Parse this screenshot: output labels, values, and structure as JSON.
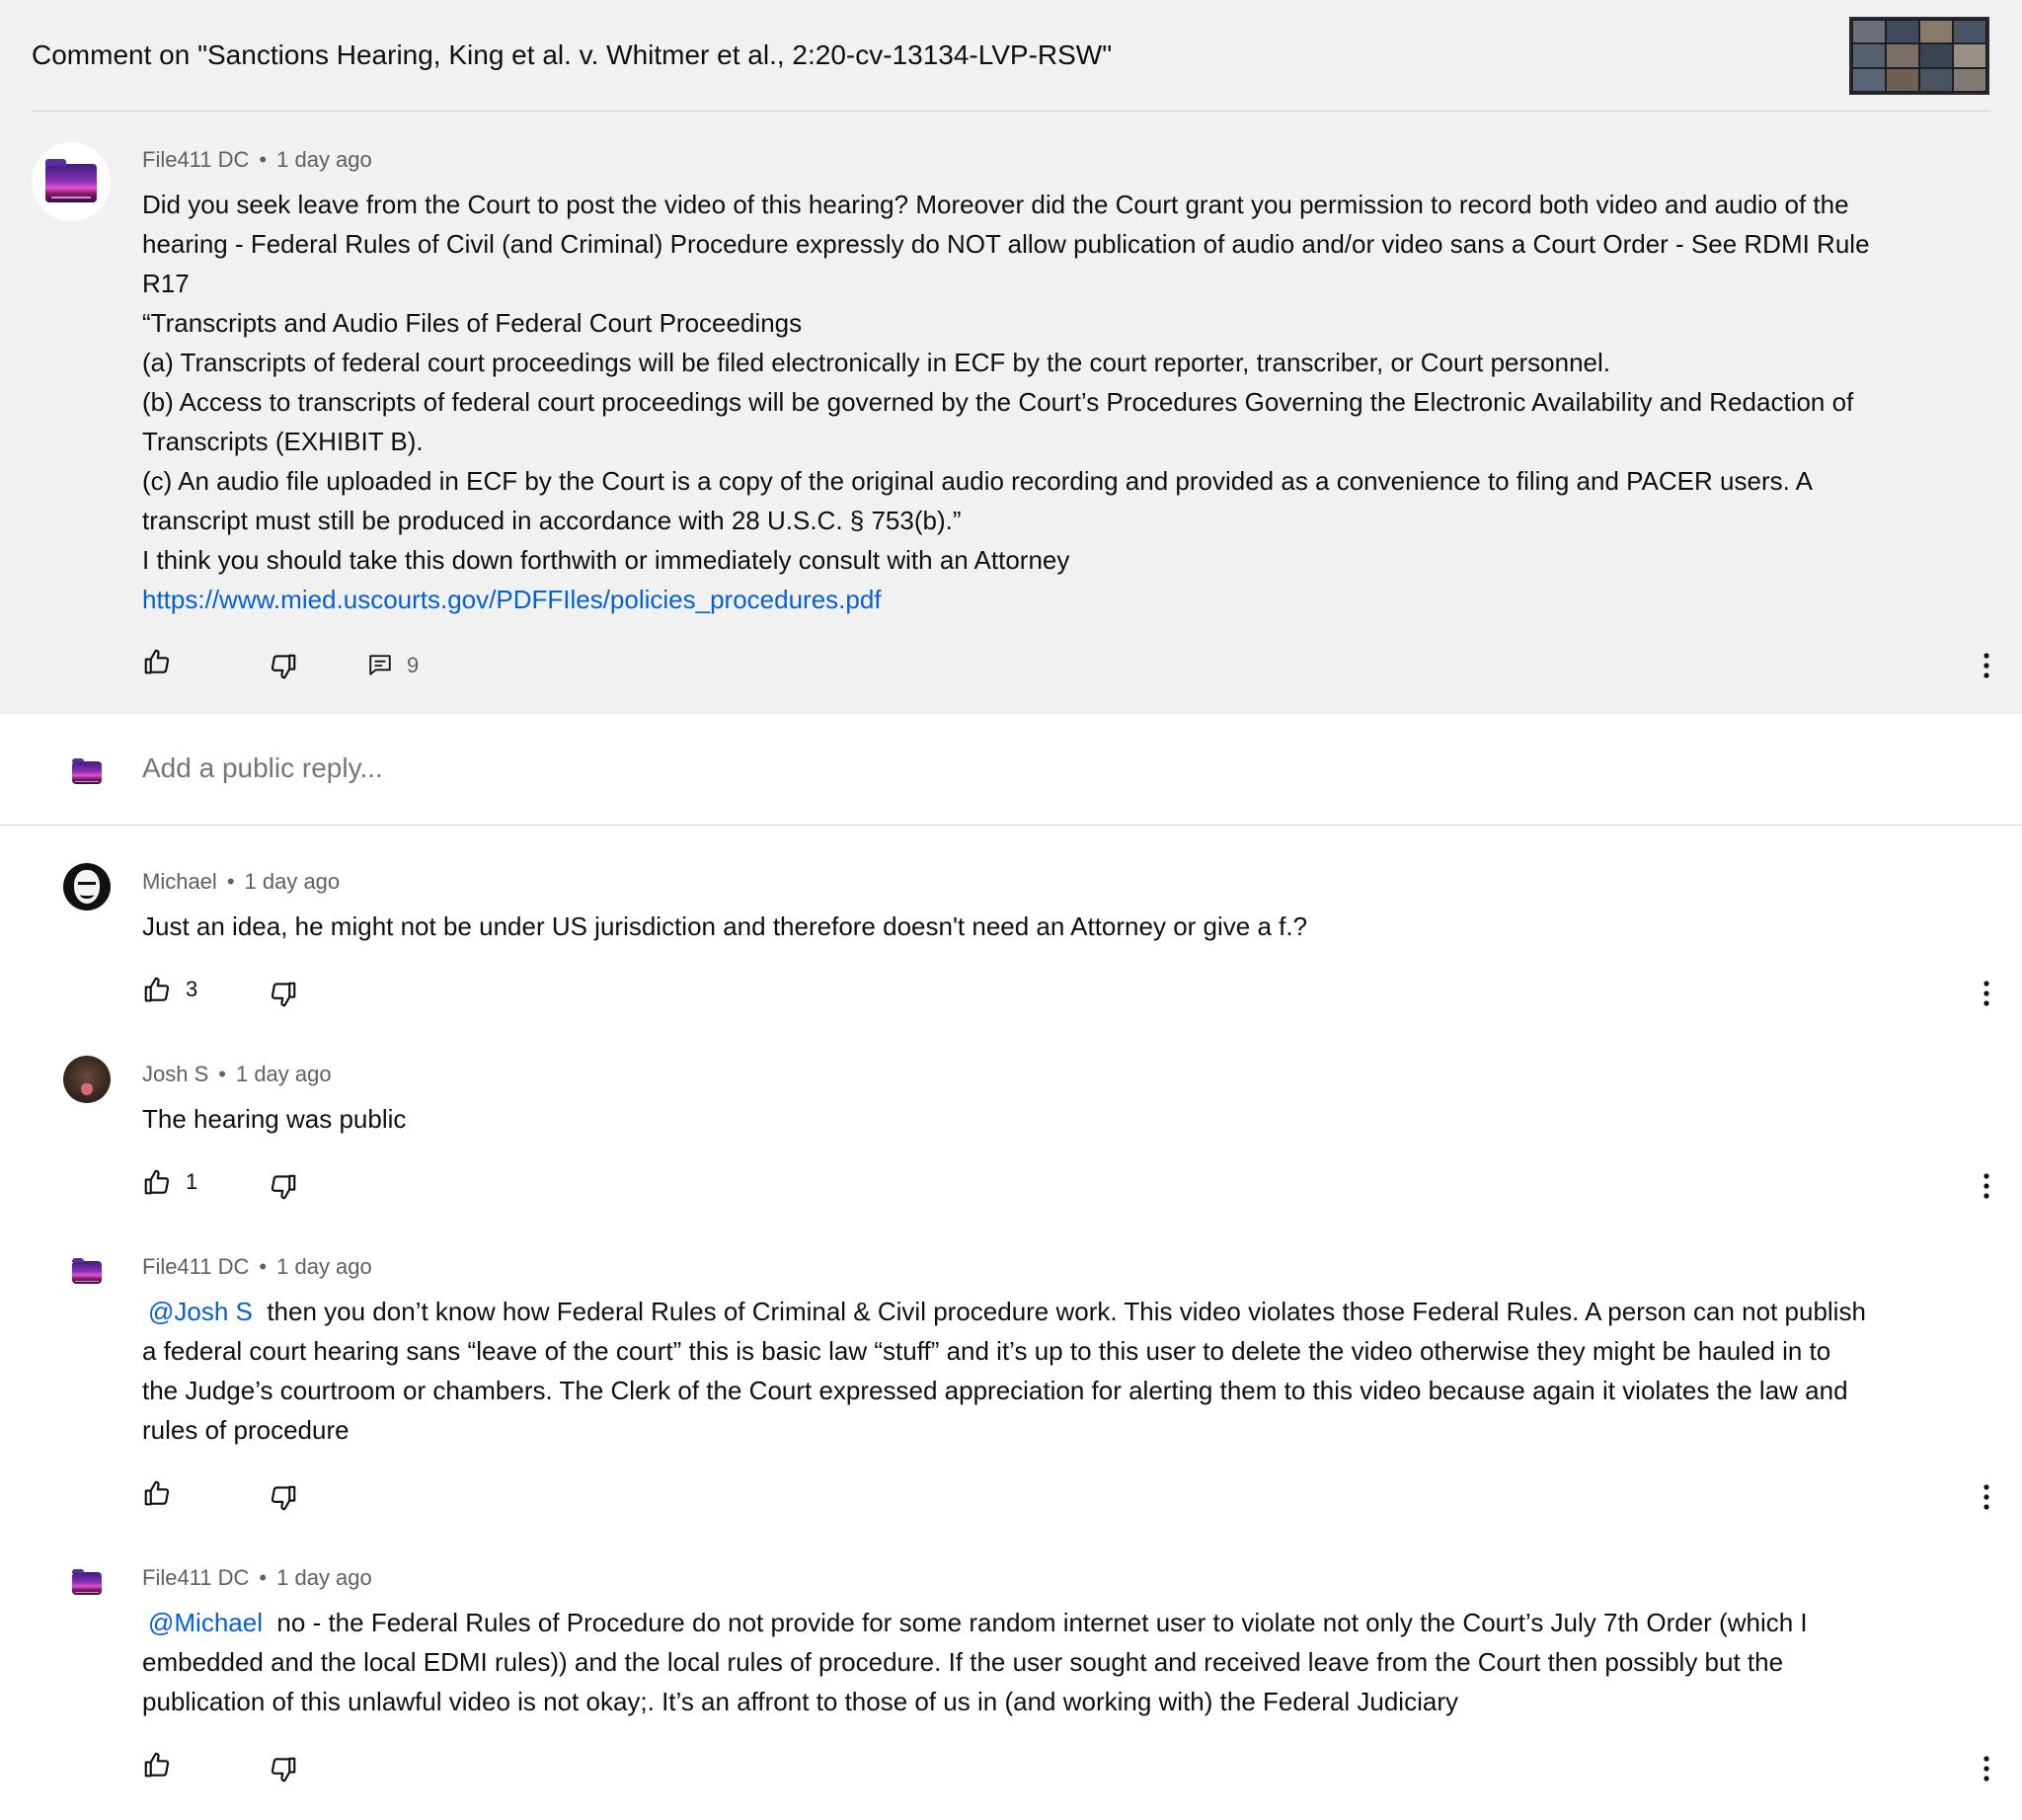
{
  "page": {
    "title": "Comment on \"Sanctions Hearing, King et al. v.  Whitmer et al., 2:20-cv-13134-LVP-RSW\""
  },
  "main_comment": {
    "author": "File411 DC",
    "time": "1 day ago",
    "lines": [
      "Did you seek leave from the Court to post the video of this hearing? Moreover did the Court grant you permission to record both video and audio of the",
      "hearing - Federal Rules of Civil (and Criminal) Procedure expressly do NOT allow publication of audio and/or video sans a Court Order - See RDMI Rule",
      "R17",
      "“Transcripts and Audio Files of Federal Court Proceedings",
      "(a) Transcripts of federal court proceedings will be filed electronically in ECF by the court reporter, transcriber, or Court personnel.",
      "(b) Access to transcripts of federal court proceedings will be governed by the Court’s Procedures Governing the Electronic Availability and Redaction of",
      "Transcripts (EXHIBIT B).",
      "(c) An audio file uploaded in ECF by the Court is a copy of the original audio recording and provided as a convenience to filing and PACER users. A",
      "transcript must still be produced in accordance with 28 U.S.C. § 753(b).”",
      "I think you should take this down forthwith or immediately consult with an Attorney"
    ],
    "link": "https://www.mied.uscourts.gov/PDFFIles/policies_procedures.pdf",
    "reply_count": "9"
  },
  "reply_box": {
    "placeholder": "Add a public reply..."
  },
  "replies": [
    {
      "author": "Michael",
      "time": "1 day ago",
      "lines": [
        "Just an idea, he might not be under US jurisdiction and therefore doesn't need an Attorney or give a f.?"
      ],
      "likes": "3"
    },
    {
      "author": "Josh S",
      "time": "1 day ago",
      "lines": [
        "The hearing was public"
      ],
      "likes": "1"
    },
    {
      "author": "File411 DC",
      "time": "1 day ago",
      "mention": "@Josh S",
      "lines": [
        "  then you don’t know how Federal Rules of Criminal & Civil procedure work. This video violates those Federal Rules. A person can not publish",
        "a federal court hearing sans “leave of the court” this is basic law “stuff” and it’s up to this user to delete the video otherwise they might be hauled in to",
        "the Judge’s courtroom or chambers. The Clerk of the Court expressed appreciation for alerting them to this video because again it violates the law and",
        "rules of procedure"
      ],
      "likes": ""
    },
    {
      "author": "File411 DC",
      "time": "1 day ago",
      "mention": "@Michael",
      "lines": [
        "  no - the Federal Rules of Procedure do not provide for some random internet user to violate not only the Court’s July 7th Order (which I",
        "embedded and the local EDMI rules)) and the local rules of procedure. If the user sought and received leave from the Court then possibly but the",
        "publication of this unlawful video is not okay;. It’s an affront to those of us in (and working with) the Federal Judiciary"
      ],
      "likes": ""
    }
  ],
  "icons": {
    "like": "thumbs-up-icon",
    "dislike": "thumbs-down-icon",
    "replies": "comment-icon",
    "more": "more-vert-icon"
  }
}
